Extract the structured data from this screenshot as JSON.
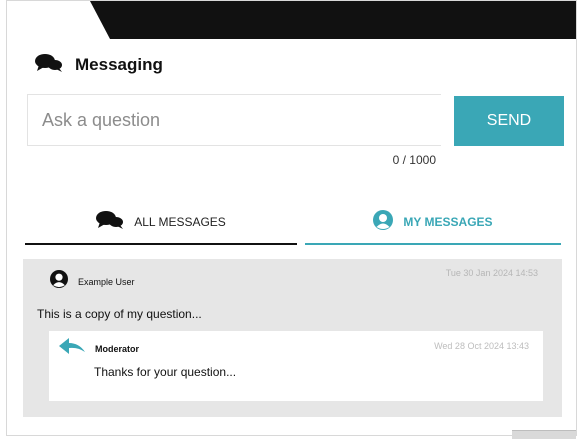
{
  "header": {
    "title": "Messaging",
    "icon": "chat-bubbles-icon"
  },
  "composer": {
    "placeholder": "Ask a question",
    "value": "",
    "send_label": "SEND",
    "counter": "0 / 1000"
  },
  "tabs": [
    {
      "label": "ALL MESSAGES",
      "icon": "chat-bubbles-icon",
      "active": false
    },
    {
      "label": "MY MESSAGES",
      "icon": "user-circle-icon",
      "active": true
    }
  ],
  "messages": [
    {
      "user": "Example User",
      "timestamp": "Tue 30 Jan 2024 14:53",
      "text": "This is a copy of my question...",
      "reply": {
        "user": "Moderator",
        "timestamp": "Wed 28 Oct 2024 13:43",
        "text": "Thanks for your question..."
      }
    }
  ],
  "colors": {
    "accent": "#3aa7b6",
    "dark": "#111111",
    "message_bg": "#e6e6e6"
  }
}
